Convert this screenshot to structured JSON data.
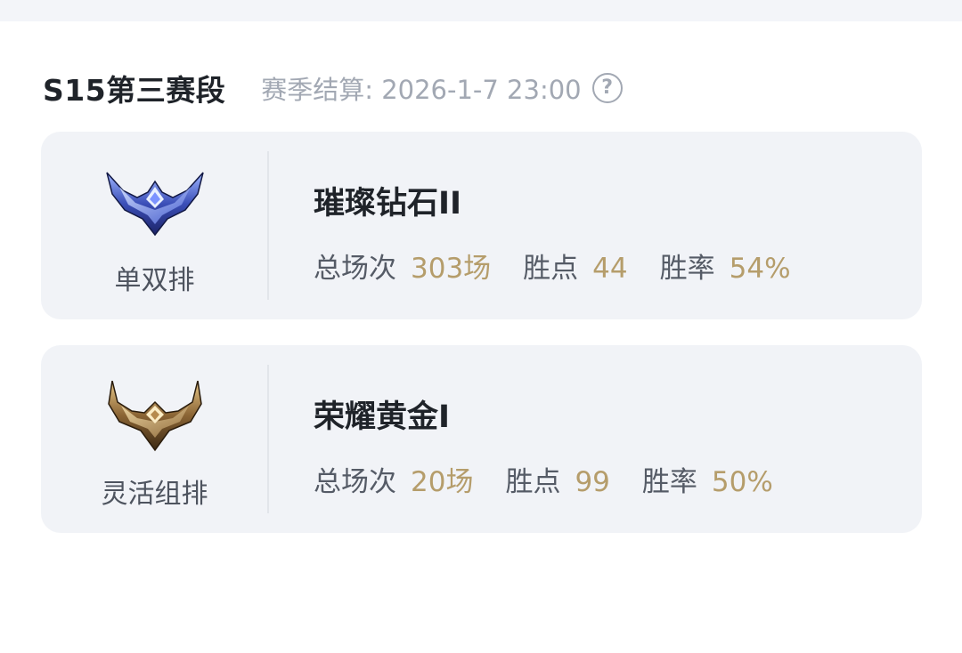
{
  "season": {
    "title": "S15第三赛段",
    "settle_text": "赛季结算: 2026-1-7 23:00",
    "help_glyph": "?"
  },
  "ranks": [
    {
      "queue": "单双排",
      "emblem_icon": "diamond-emblem-icon",
      "tier": "璀璨钻石II",
      "games_label": "总场次",
      "games_value": "303场",
      "lp_label": "胜点",
      "lp_value": "44",
      "winrate_label": "胜率",
      "winrate_value": "54%"
    },
    {
      "queue": "灵活组排",
      "emblem_icon": "gold-emblem-icon",
      "tier": "荣耀黄金I",
      "games_label": "总场次",
      "games_value": "20场",
      "lp_label": "胜点",
      "lp_value": "99",
      "winrate_label": "胜率",
      "winrate_value": "50%"
    }
  ],
  "colors": {
    "accent_value": "#b59d6b",
    "card_bg": "#f1f3f7",
    "muted_text": "#a2a8b3"
  }
}
